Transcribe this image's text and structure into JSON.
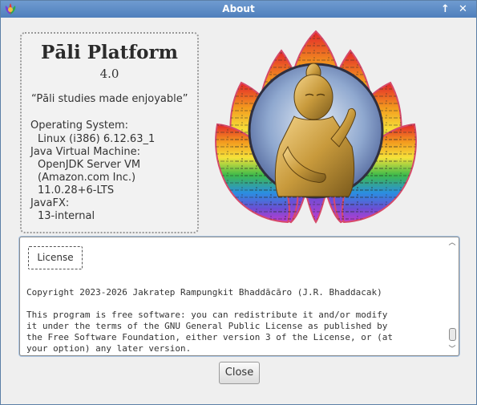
{
  "window": {
    "title": "About",
    "controls": {
      "minimize": "↑",
      "close": "✕"
    },
    "accent": "#4f7fbc"
  },
  "about": {
    "app_name": "Pāli Platform",
    "version": "4.0",
    "tagline": "“Pāli studies made enjoyable”",
    "os_label": "Operating System:",
    "os_value": "Linux (i386) 6.12.63_1",
    "jvm_label": "Java Virtual Machine:",
    "jvm_name": "OpenJDK Server VM",
    "jvm_vendor": "(Amazon.com Inc.)",
    "jvm_version": "11.0.28+6-LTS",
    "javafx_label": "JavaFX:",
    "javafx_version": "13-internal"
  },
  "logo": {
    "icon": "buddha-lotus-logo"
  },
  "license": {
    "button_label": "License",
    "copyright": "Copyright 2023-2026 Jakratep Rampungkit Bhaddācāro (J.R. Bhaddacak)",
    "body_lines": [
      "This program is free software: you can redistribute it and/or modify",
      "it under the terms of the GNU General Public License as published by",
      "the Free Software Foundation, either version 3 of the License, or (at",
      "your option) any later version."
    ]
  },
  "footer": {
    "close_label": "Close"
  }
}
